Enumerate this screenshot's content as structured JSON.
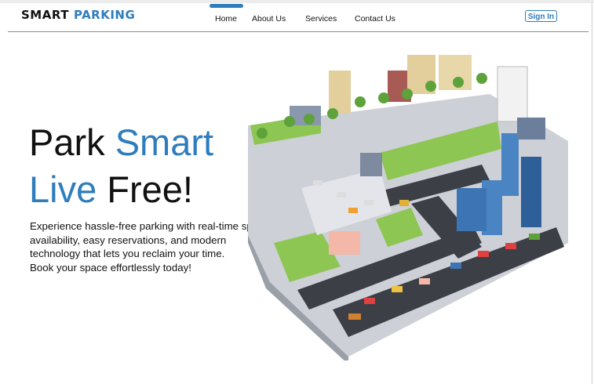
{
  "brand": {
    "word1": "SMART",
    "word2": "PARKING"
  },
  "nav": {
    "home": "Home",
    "about": "About Us",
    "services": "Services",
    "contact": "Contact Us",
    "signin": "Sign In"
  },
  "hero": {
    "line1_a": "Park",
    "line1_b": "Smart",
    "line2_a": "Live",
    "line2_b": "Free!",
    "para": "Experience hassle-free parking with real-time spot availability, easy reservations, and modern technology that lets you reclaim your time.",
    "para2": "Book your space effortlessly today!"
  },
  "colors": {
    "accent": "#2e7dbd",
    "grass": "#8dc653",
    "road": "#3c3f45",
    "building": "#4a84c2"
  }
}
